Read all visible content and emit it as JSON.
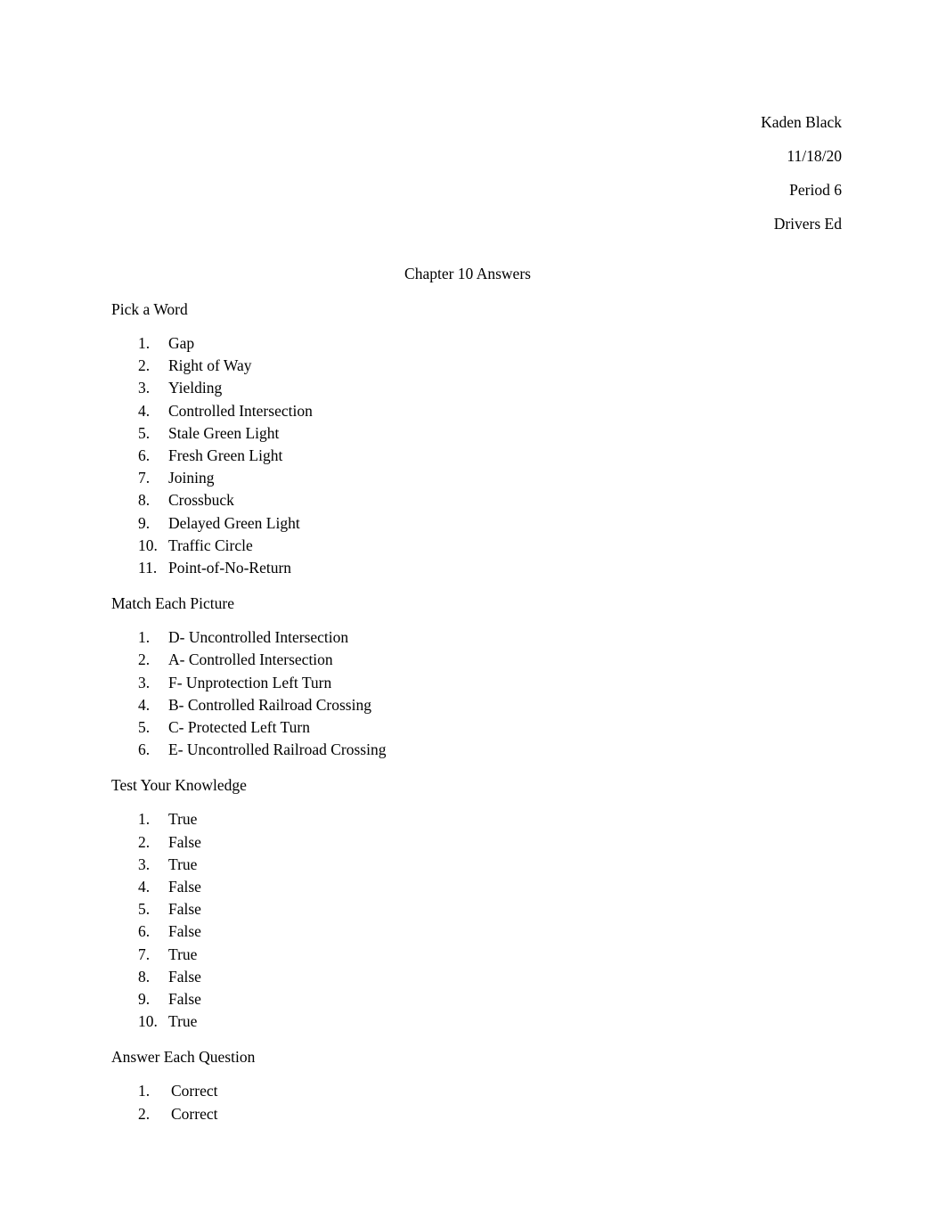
{
  "document": {
    "header_lines": [
      "Kaden Black",
      "11/18/20",
      "Period 6",
      "Drivers Ed"
    ],
    "title": "Chapter 10 Answers",
    "sections": [
      {
        "heading": "Pick a Word",
        "items": [
          "Gap",
          "Right of Way",
          "Yielding",
          "Controlled Intersection",
          "Stale Green Light",
          "Fresh Green Light",
          "Joining",
          "Crossbuck",
          "Delayed Green Light",
          "Traffic Circle",
          "Point-of-No-Return"
        ],
        "numbers": [
          "1.",
          "2.",
          "3.",
          "4.",
          "5.",
          "6.",
          "7.",
          "8.",
          "9.",
          "10.",
          "11."
        ],
        "extra_indent": false
      },
      {
        "heading": "Match Each Picture",
        "items": [
          "D- Uncontrolled Intersection",
          "A- Controlled Intersection",
          "F- Unprotection Left Turn",
          "B- Controlled Railroad Crossing",
          "C- Protected Left Turn",
          "E- Uncontrolled Railroad Crossing"
        ],
        "numbers": [
          "1.",
          "2.",
          "3.",
          "4.",
          "5.",
          "6."
        ],
        "extra_indent": false
      },
      {
        "heading": "Test Your Knowledge",
        "items": [
          "True",
          "False",
          "True",
          "False",
          "False",
          "False",
          "True",
          "False",
          "False",
          "True"
        ],
        "numbers": [
          "1.",
          "2.",
          "3.",
          "4.",
          "5.",
          "6.",
          "7.",
          "8.",
          "9.",
          "10."
        ],
        "extra_indent": false
      },
      {
        "heading": "Answer Each Question",
        "items": [
          "Correct",
          "Correct"
        ],
        "numbers": [
          "1.",
          "2."
        ],
        "extra_indent": true
      }
    ]
  }
}
